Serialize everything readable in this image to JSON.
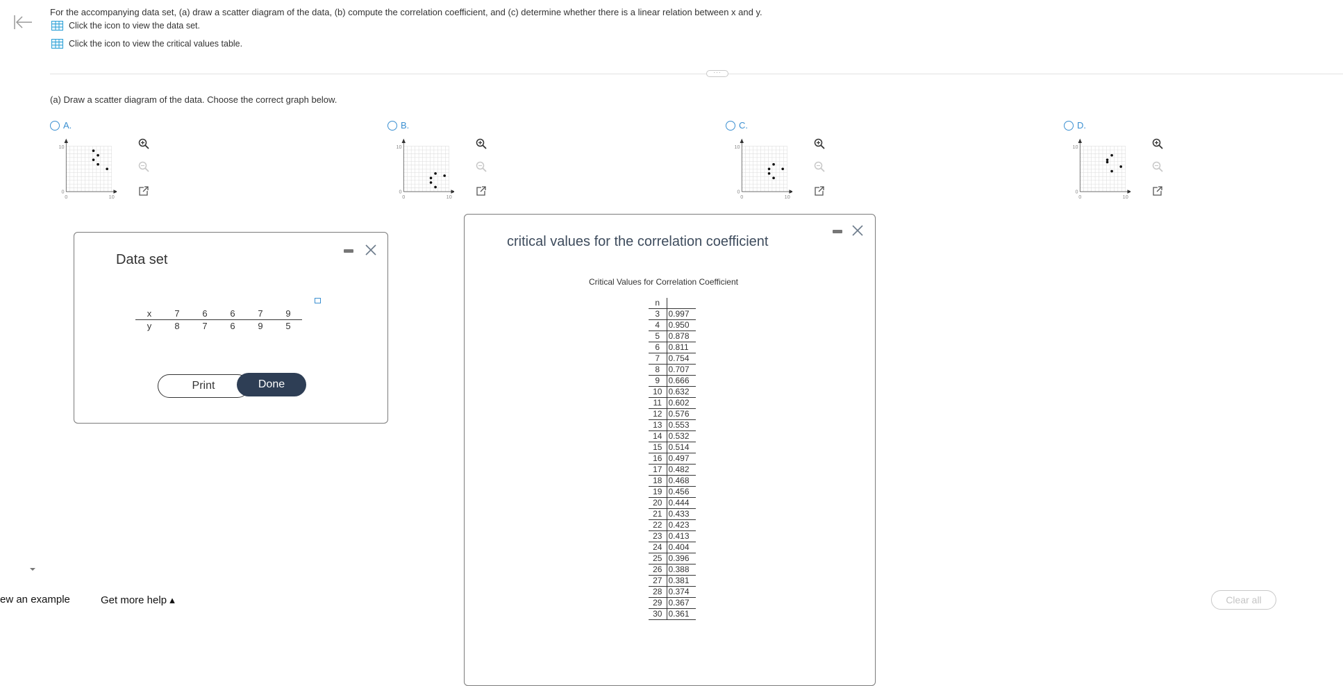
{
  "question": {
    "prompt": "For the accompanying data set, (a) draw a scatter diagram of the data, (b) compute the correlation coefficient, and (c) determine whether there is a linear relation between x and y.",
    "link_data_set": "Click the icon to view the data set.",
    "link_critical_values": "Click the icon to view the critical values table.",
    "part_a": "(a) Draw a scatter diagram of the data. Choose the correct graph below."
  },
  "options": [
    {
      "label": "A.",
      "y_max_label": "10",
      "x_min_label": "0",
      "x_max_label": "10",
      "y_min_label": "0",
      "points": [
        [
          6,
          9
        ],
        [
          7,
          8
        ],
        [
          6,
          7
        ],
        [
          7,
          6
        ],
        [
          9,
          5
        ]
      ]
    },
    {
      "label": "B.",
      "y_max_label": "10",
      "x_min_label": "0",
      "x_max_label": "10",
      "y_min_label": "0",
      "points": [
        [
          7,
          4
        ],
        [
          6,
          3
        ],
        [
          6,
          2
        ],
        [
          7,
          1
        ],
        [
          9,
          3.5
        ]
      ]
    },
    {
      "label": "C.",
      "y_max_label": "10",
      "x_min_label": "0",
      "x_max_label": "10",
      "y_min_label": "0",
      "points": [
        [
          7,
          6
        ],
        [
          6,
          4
        ],
        [
          6,
          5
        ],
        [
          7,
          3
        ],
        [
          9,
          5
        ]
      ]
    },
    {
      "label": "D.",
      "y_max_label": "10",
      "x_min_label": "0",
      "x_max_label": "10",
      "y_min_label": "0",
      "points": [
        [
          7,
          8
        ],
        [
          6,
          7
        ],
        [
          6,
          6.5
        ],
        [
          7,
          4.5
        ],
        [
          9,
          5.5
        ]
      ]
    }
  ],
  "data_set_dialog": {
    "title": "Data set",
    "x_label": "x",
    "y_label": "y",
    "x_values": [
      "7",
      "6",
      "6",
      "7",
      "9"
    ],
    "y_values": [
      "8",
      "7",
      "6",
      "9",
      "5"
    ],
    "print_label": "Print",
    "done_label": "Done"
  },
  "critical_dialog": {
    "title": "critical values for the correlation coefficient",
    "caption": "Critical Values for Correlation Coefficient",
    "n_header": "n",
    "rows": [
      {
        "n": "3",
        "v": "0.997"
      },
      {
        "n": "4",
        "v": "0.950"
      },
      {
        "n": "5",
        "v": "0.878"
      },
      {
        "n": "6",
        "v": "0.811"
      },
      {
        "n": "7",
        "v": "0.754"
      },
      {
        "n": "8",
        "v": "0.707"
      },
      {
        "n": "9",
        "v": "0.666"
      },
      {
        "n": "10",
        "v": "0.632"
      },
      {
        "n": "11",
        "v": "0.602"
      },
      {
        "n": "12",
        "v": "0.576"
      },
      {
        "n": "13",
        "v": "0.553"
      },
      {
        "n": "14",
        "v": "0.532"
      },
      {
        "n": "15",
        "v": "0.514"
      },
      {
        "n": "16",
        "v": "0.497"
      },
      {
        "n": "17",
        "v": "0.482"
      },
      {
        "n": "18",
        "v": "0.468"
      },
      {
        "n": "19",
        "v": "0.456"
      },
      {
        "n": "20",
        "v": "0.444"
      },
      {
        "n": "21",
        "v": "0.433"
      },
      {
        "n": "22",
        "v": "0.423"
      },
      {
        "n": "23",
        "v": "0.413"
      },
      {
        "n": "24",
        "v": "0.404"
      },
      {
        "n": "25",
        "v": "0.396"
      },
      {
        "n": "26",
        "v": "0.388"
      },
      {
        "n": "27",
        "v": "0.381"
      },
      {
        "n": "28",
        "v": "0.374"
      },
      {
        "n": "29",
        "v": "0.367"
      },
      {
        "n": "30",
        "v": "0.361"
      }
    ]
  },
  "footer": {
    "view_example": "ew an example",
    "get_more_help": "Get more help ▴",
    "clear_all": "Clear all"
  },
  "colors": {
    "link_blue": "#3a8fd1",
    "icon_teal": "#2a9fd6",
    "done_bg": "#2e3e55"
  }
}
